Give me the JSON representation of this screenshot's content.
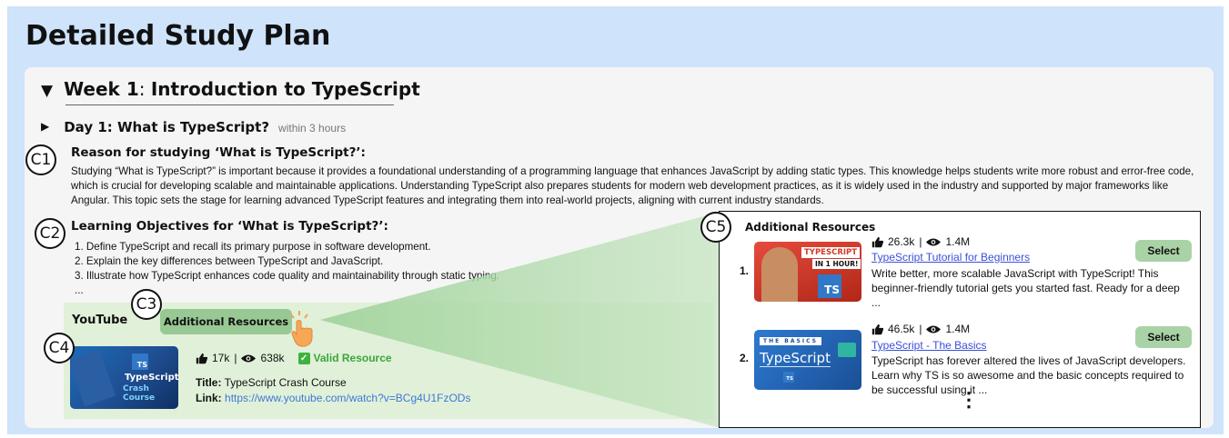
{
  "page_title": "Detailed Study Plan",
  "week": {
    "label": "Week 1",
    "separator": ": ",
    "topic": "Introduction to TypeScript"
  },
  "day": {
    "title": "Day 1: What is TypeScript?",
    "duration": "within 3 hours"
  },
  "markers": {
    "c1": "C1",
    "c2": "C2",
    "c3": "C3",
    "c4": "C4",
    "c5": "C5"
  },
  "reason": {
    "heading": "Reason for studying ‘What is TypeScript?’:",
    "text": "Studying “What is TypeScript?” is important because it provides a foundational understanding of a programming language that enhances JavaScript by adding static types. This knowledge helps students write more robust and error-free code, which is crucial for developing scalable and maintainable applications. Understanding TypeScript also prepares students for modern web development practices, as it is widely used in the industry and supported by major frameworks like Angular. This topic sets the stage for learning advanced TypeScript features and integrating them into real-world projects, aligning with current industry standards."
  },
  "objectives": {
    "heading": "Learning Objectives for ‘What is TypeScript?’:",
    "items": [
      "1. Define TypeScript and recall its primary purpose in software development.",
      "2. Explain the key differences between TypeScript and JavaScript.",
      "3. Illustrate how TypeScript enhances code quality and maintainability through static typing."
    ],
    "more": "..."
  },
  "youtube": {
    "label": "YouTube",
    "additional_button": "Additional Resources",
    "likes": "17k",
    "views": "638k",
    "stat_sep": "|",
    "valid_label": "Valid Resource",
    "title_label": "Title:",
    "title": "TypeScript Crash Course",
    "link_label": "Link:",
    "link": "https://www.youtube.com/watch?v=BCg4U1FzODs",
    "thumb_text": "TypeScript",
    "thumb_sub": "Crash Course",
    "thumb_logo": "TS"
  },
  "additional_resources": {
    "heading": "Additional Resources",
    "select_label": "Select",
    "more": "⋮",
    "items": [
      {
        "num": "1.",
        "likes": "26.3k",
        "views": "1.4M",
        "sep": "|",
        "title": "TypeScript Tutorial for Beginners",
        "desc": "Write better, more scalable JavaScript with TypeScript! This beginner-friendly tutorial gets you started fast. Ready for a deep ...",
        "thumb_line1": "TYPESCRIPT",
        "thumb_line2": "IN 1 HOUR!",
        "thumb_logo": "TS"
      },
      {
        "num": "2.",
        "likes": "46.5k",
        "views": "1.4M",
        "sep": "|",
        "title": "TypeScript - The Basics",
        "desc": "TypeScript has forever altered the lives of JavaScript developers. Learn why TS is so awesome and the basic concepts required to be successful using it ...",
        "thumb_tag": "THE BASICS",
        "thumb_text": "TypeScript",
        "thumb_logo": "TS"
      }
    ]
  },
  "colors": {
    "page_bg": "#cfe3fa",
    "card_bg": "#f5f5f5",
    "youtube_panel": "#e1f0d8",
    "button_green": "#98c994",
    "select_green": "#a9d3a6",
    "valid_green": "#3aa63a",
    "link_blue": "#3b7ad9"
  },
  "icons": {
    "expand": "triangle-down-icon",
    "collapse": "triangle-right-icon",
    "like": "thumbs-up-icon",
    "views": "eye-icon",
    "valid": "checkbox-check-icon",
    "cursor": "pointing-hand-icon"
  }
}
